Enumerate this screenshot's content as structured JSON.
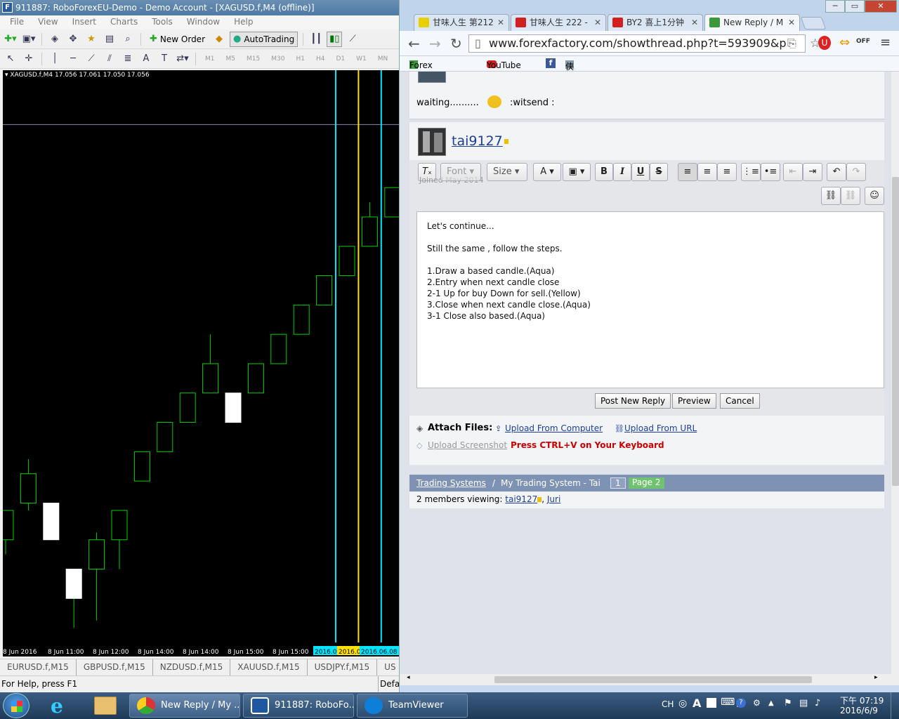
{
  "mt4": {
    "title": "911887: RoboForexEU-Demo - Demo Account - [XAGUSD.f,M4 (offline)]",
    "menu": [
      "File",
      "View",
      "Insert",
      "Charts",
      "Tools",
      "Window",
      "Help"
    ],
    "toolbar": {
      "new_order": "New Order",
      "autotrading": "AutoTrading"
    },
    "timeframes": [
      "M1",
      "M5",
      "M15",
      "M30",
      "H1",
      "H4",
      "D1",
      "W1",
      "MN"
    ],
    "chart_info": "XAGUSD.f,M4  17.056 17.061 17.050 17.056",
    "symbol_tabs": [
      "EURUSD.f,M15",
      "GBPUSD.f,M15",
      "NZDUSD.f,M15",
      "XAUUSD.f,M15",
      "USDJPY.f,M15",
      "US"
    ],
    "status": "For Help, press F1",
    "status_right": "Defa",
    "colors": {
      "bull_candle": "#00d000",
      "vline_aqua": "#00e5ff",
      "vline_yellow": "#ffe000",
      "bg": "#000000"
    }
  },
  "chart_data": {
    "type": "candlestick",
    "symbol": "XAGUSD.f,M4",
    "x_ticks": [
      "8 Jun 2016",
      "8 Jun 11:00",
      "8 Jun 12:00",
      "8 Jun 14:00",
      "8 Jun 14:00",
      "8 Jun 15:00",
      "8 Jun 15:00"
    ],
    "x_highlight_labels": [
      "2016.0",
      "2016.0",
      "2016.06.08 1"
    ],
    "candles": [
      {
        "o": 17.0,
        "c": 17.2,
        "h": 17.2,
        "l": 16.9,
        "dir": "up"
      },
      {
        "o": 17.25,
        "c": 17.45,
        "h": 17.55,
        "l": 17.2,
        "dir": "up"
      },
      {
        "o": 17.25,
        "c": 17.0,
        "h": 17.25,
        "l": 17.0,
        "dir": "down"
      },
      {
        "o": 16.8,
        "c": 16.6,
        "h": 16.8,
        "l": 16.4,
        "dir": "down"
      },
      {
        "o": 16.8,
        "c": 17.0,
        "h": 17.05,
        "l": 16.45,
        "dir": "up"
      },
      {
        "o": 17.0,
        "c": 17.2,
        "h": 17.2,
        "l": 16.8,
        "dir": "up"
      },
      {
        "o": 17.4,
        "c": 17.6,
        "h": 17.6,
        "l": 17.4,
        "dir": "up"
      },
      {
        "o": 17.6,
        "c": 17.8,
        "h": 17.8,
        "l": 17.6,
        "dir": "up"
      },
      {
        "o": 17.8,
        "c": 18.0,
        "h": 18.0,
        "l": 17.8,
        "dir": "up"
      },
      {
        "o": 18.0,
        "c": 18.2,
        "h": 18.4,
        "l": 18.0,
        "dir": "up"
      },
      {
        "o": 18.0,
        "c": 17.8,
        "h": 18.0,
        "l": 17.8,
        "dir": "down"
      },
      {
        "o": 18.0,
        "c": 18.2,
        "h": 18.2,
        "l": 18.0,
        "dir": "up"
      },
      {
        "o": 18.2,
        "c": 18.4,
        "h": 18.4,
        "l": 18.2,
        "dir": "up"
      },
      {
        "o": 18.4,
        "c": 18.6,
        "h": 18.6,
        "l": 18.4,
        "dir": "up"
      },
      {
        "o": 18.6,
        "c": 18.8,
        "h": 18.8,
        "l": 18.6,
        "dir": "up"
      },
      {
        "o": 18.8,
        "c": 19.0,
        "h": 19.0,
        "l": 18.8,
        "dir": "up"
      },
      {
        "o": 19.0,
        "c": 19.2,
        "h": 19.3,
        "l": 19.0,
        "dir": "up"
      },
      {
        "o": 19.2,
        "c": 19.4,
        "h": 19.4,
        "l": 19.2,
        "dir": "up"
      },
      {
        "o": 19.4,
        "c": 19.6,
        "h": 19.6,
        "l": 19.4,
        "dir": "up"
      },
      {
        "o": 19.6,
        "c": 19.8,
        "h": 19.8,
        "l": 19.6,
        "dir": "up"
      }
    ],
    "ylim": [
      16.3,
      20.2
    ],
    "hline": 19.83,
    "vlines": [
      {
        "candle": 15,
        "color": "aqua"
      },
      {
        "candle": 16,
        "color": "yellow"
      },
      {
        "candle": 17,
        "color": "aqua"
      }
    ]
  },
  "chrome": {
    "tabs": [
      {
        "label": "甘味人生 第212",
        "fav": "#e8d000"
      },
      {
        "label": "甘味人生 222 -",
        "fav": "#d02020"
      },
      {
        "label": "BY2 喜上1分钟",
        "fav": "#d02020"
      },
      {
        "label": "New Reply / M",
        "fav": "#3a9a3a"
      }
    ],
    "url": "www.forexfactory.com/showthread.php?t=593909&p",
    "bookmarks": [
      "Forex Factory",
      "YouTube",
      "侠盗猎车手5汉化版下"
    ]
  },
  "forum": {
    "prev_post_text": "waiting..........",
    "prev_post_emote": ":witsend :",
    "username": "tai9127",
    "joined": "Joined May 2014",
    "toolbar": {
      "font": "Font",
      "size": "Size"
    },
    "editor_lines": [
      "Let's continue...",
      "",
      "Still the same , follow the steps.",
      "",
      "1.Draw a based candle.(Aqua)",
      "2.Entry when next candle close",
      "2-1 Up for buy Down for sell.(Yellow)",
      "3.Close when next candle close.(Aqua)",
      "3-1 Close also based.(Aqua)"
    ],
    "buttons": {
      "post": "Post New Reply",
      "preview": "Preview",
      "cancel": "Cancel"
    },
    "attach": {
      "label": "Attach Files:",
      "from_computer": "Upload From Computer",
      "from_url": "Upload From URL",
      "screenshot": "Upload Screenshot",
      "hint": "Press CTRL+V on Your Keyboard"
    },
    "breadcrumb": {
      "section": "Trading Systems",
      "sep": "/",
      "thread": "My Trading System - Tai",
      "page1": "1",
      "page2": "Page 2"
    },
    "viewing": {
      "text": "2 members viewing:",
      "user1": "tai9127",
      "user2": "Juri"
    }
  },
  "taskbar": {
    "tasks": [
      "New Reply / My ...",
      "911887: RoboFo...",
      "TeamViewer"
    ],
    "lang": "CH",
    "time": "下午 07:19",
    "date": "2016/6/9"
  }
}
